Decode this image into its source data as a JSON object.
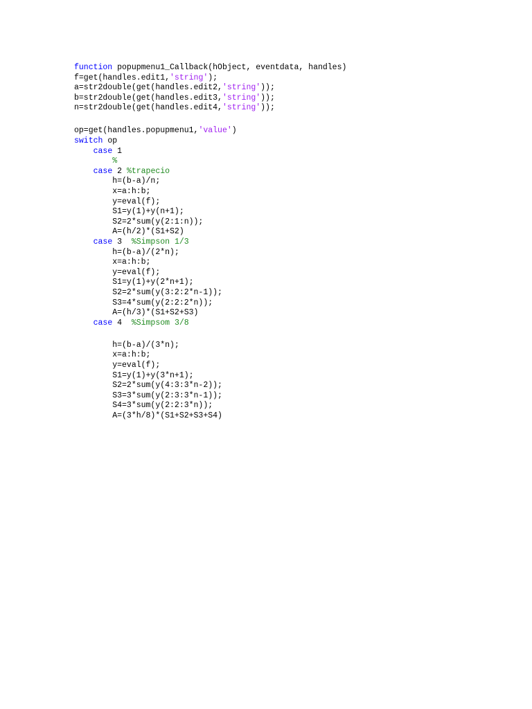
{
  "code_lines": [
    {
      "tokens": [
        {
          "t": "function",
          "c": "kw"
        },
        {
          "t": " popupmenu1_Callback(hObject, eventdata, handles)",
          "c": "plain"
        }
      ]
    },
    {
      "tokens": [
        {
          "t": "f=get(handles.edit1,",
          "c": "plain"
        },
        {
          "t": "'string'",
          "c": "str"
        },
        {
          "t": ");",
          "c": "plain"
        }
      ]
    },
    {
      "tokens": [
        {
          "t": "a=str2double(get(handles.edit2,",
          "c": "plain"
        },
        {
          "t": "'string'",
          "c": "str"
        },
        {
          "t": "));",
          "c": "plain"
        }
      ]
    },
    {
      "tokens": [
        {
          "t": "b=str2double(get(handles.edit3,",
          "c": "plain"
        },
        {
          "t": "'string'",
          "c": "str"
        },
        {
          "t": "));",
          "c": "plain"
        }
      ]
    },
    {
      "tokens": [
        {
          "t": "n=str2double(get(handles.edit4,",
          "c": "plain"
        },
        {
          "t": "'string'",
          "c": "str"
        },
        {
          "t": "));",
          "c": "plain"
        }
      ]
    },
    {
      "blank": true
    },
    {
      "tokens": [
        {
          "t": "op=get(handles.popupmenu1,",
          "c": "plain"
        },
        {
          "t": "'value'",
          "c": "str"
        },
        {
          "t": ")",
          "c": "plain"
        }
      ]
    },
    {
      "tokens": [
        {
          "t": "switch",
          "c": "kw"
        },
        {
          "t": " op",
          "c": "plain"
        }
      ]
    },
    {
      "tokens": [
        {
          "t": "    ",
          "c": "plain"
        },
        {
          "t": "case",
          "c": "kw"
        },
        {
          "t": " 1",
          "c": "plain"
        }
      ]
    },
    {
      "tokens": [
        {
          "t": "        ",
          "c": "plain"
        },
        {
          "t": "%",
          "c": "cmt"
        }
      ]
    },
    {
      "tokens": [
        {
          "t": "    ",
          "c": "plain"
        },
        {
          "t": "case",
          "c": "kw"
        },
        {
          "t": " 2 ",
          "c": "plain"
        },
        {
          "t": "%trapecio",
          "c": "cmt"
        }
      ]
    },
    {
      "tokens": [
        {
          "t": "        h=(b-a)/n;",
          "c": "plain"
        }
      ]
    },
    {
      "tokens": [
        {
          "t": "        x=a:h:b;",
          "c": "plain"
        }
      ]
    },
    {
      "tokens": [
        {
          "t": "        y=eval(f);",
          "c": "plain"
        }
      ]
    },
    {
      "tokens": [
        {
          "t": "        S1=y(1)+y(n+1);",
          "c": "plain"
        }
      ]
    },
    {
      "tokens": [
        {
          "t": "        S2=2*sum(y(2:1:n));",
          "c": "plain"
        }
      ]
    },
    {
      "tokens": [
        {
          "t": "        A=(h/2)*(S1+S2)",
          "c": "plain"
        }
      ]
    },
    {
      "tokens": [
        {
          "t": "    ",
          "c": "plain"
        },
        {
          "t": "case",
          "c": "kw"
        },
        {
          "t": " 3  ",
          "c": "plain"
        },
        {
          "t": "%Simpson 1/3",
          "c": "cmt"
        }
      ]
    },
    {
      "tokens": [
        {
          "t": "        h=(b-a)/(2*n);",
          "c": "plain"
        }
      ]
    },
    {
      "tokens": [
        {
          "t": "        x=a:h:b;",
          "c": "plain"
        }
      ]
    },
    {
      "tokens": [
        {
          "t": "        y=eval(f);",
          "c": "plain"
        }
      ]
    },
    {
      "tokens": [
        {
          "t": "        S1=y(1)+y(2*n+1);",
          "c": "plain"
        }
      ]
    },
    {
      "tokens": [
        {
          "t": "        S2=2*sum(y(3:2:2*n-1));",
          "c": "plain"
        }
      ]
    },
    {
      "tokens": [
        {
          "t": "        S3=4*sum(y(2:2:2*n));",
          "c": "plain"
        }
      ]
    },
    {
      "tokens": [
        {
          "t": "        A=(h/3)*(S1+S2+S3)",
          "c": "plain"
        }
      ]
    },
    {
      "tokens": [
        {
          "t": "    ",
          "c": "plain"
        },
        {
          "t": "case",
          "c": "kw"
        },
        {
          "t": " 4  ",
          "c": "plain"
        },
        {
          "t": "%Simpsom 3/8",
          "c": "cmt"
        }
      ]
    },
    {
      "blank": true,
      "small": true
    },
    {
      "tokens": [
        {
          "t": "        h=(b-a)/(3*n);",
          "c": "plain"
        }
      ]
    },
    {
      "tokens": [
        {
          "t": "        x=a:h:b;",
          "c": "plain"
        }
      ]
    },
    {
      "tokens": [
        {
          "t": "        y=eval(f);",
          "c": "plain"
        }
      ]
    },
    {
      "tokens": [
        {
          "t": "        S1=y(1)+y(3*n+1);",
          "c": "plain"
        }
      ]
    },
    {
      "tokens": [
        {
          "t": "        S2=2*sum(y(4:3:3*n-2));",
          "c": "plain"
        }
      ]
    },
    {
      "tokens": [
        {
          "t": "        S3=3*sum(y(2:3:3*n-1));",
          "c": "plain"
        }
      ]
    },
    {
      "tokens": [
        {
          "t": "        S4=3*sum(y(2:2:3*n));",
          "c": "plain"
        }
      ]
    },
    {
      "tokens": [
        {
          "t": "        A=(3*h/8)*(S1+S2+S3+S4)",
          "c": "plain"
        }
      ]
    }
  ],
  "colors": {
    "keyword": "#0000ff",
    "string": "#a020f0",
    "comment": "#228b22",
    "text": "#000000",
    "background": "#ffffff"
  }
}
